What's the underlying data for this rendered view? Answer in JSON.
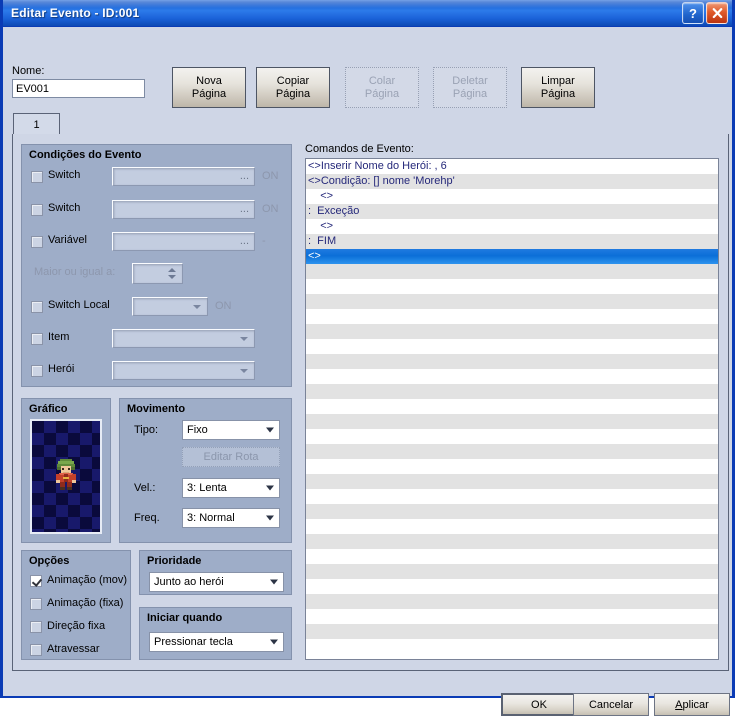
{
  "window": {
    "title": "Editar Evento - ID:001",
    "help_button": "?",
    "close_button": "✕"
  },
  "header": {
    "name_label": "Nome:",
    "name_value": "EV001",
    "page_buttons": [
      {
        "label": "Nova\nPágina",
        "name": "nova-pagina",
        "disabled": false
      },
      {
        "label": "Copiar\nPágina",
        "name": "copiar-pagina",
        "disabled": false
      },
      {
        "label": "Colar\nPágina",
        "name": "colar-pagina",
        "disabled": true
      },
      {
        "label": "Deletar\nPágina",
        "name": "deletar-pagina",
        "disabled": true
      },
      {
        "label": "Limpar\nPágina",
        "name": "limpar-pagina",
        "disabled": false
      }
    ]
  },
  "tabs": [
    {
      "label": "1",
      "active": true
    }
  ],
  "conditions": {
    "title": "Condições do Evento",
    "rows": [
      {
        "label": "Switch",
        "checked": false,
        "value": "",
        "dots": "...",
        "suffix": "ON"
      },
      {
        "label": "Switch",
        "checked": false,
        "value": "",
        "dots": "...",
        "suffix": "ON"
      },
      {
        "label": "Variável",
        "checked": false,
        "value": "",
        "dots": "...",
        "suffix": "-"
      },
      {
        "label": "Maior ou igual a:",
        "checked": null,
        "value": "",
        "dots": "",
        "suffix": ""
      },
      {
        "label": "Switch Local",
        "checked": false,
        "value": "",
        "dots": "",
        "suffix": "ON"
      },
      {
        "label": "Item",
        "checked": false,
        "value": "",
        "dots": "",
        "suffix": ""
      },
      {
        "label": "Herói",
        "checked": false,
        "value": "",
        "dots": "",
        "suffix": ""
      }
    ]
  },
  "graphic": {
    "title": "Gráfico",
    "sprite_name": "hero-sprite-green-hair-red-armor"
  },
  "movement": {
    "title": "Movimento",
    "tipo_label": "Tipo:",
    "tipo_value": "Fixo",
    "editar_rota_label": "Editar Rota",
    "vel_label": "Vel.:",
    "vel_value": "3: Lenta",
    "freq_label": "Freq.",
    "freq_value": "3: Normal"
  },
  "options": {
    "title": "Opções",
    "items": [
      {
        "label": "Animação (mov)",
        "checked": true
      },
      {
        "label": "Animação (fixa)",
        "checked": false
      },
      {
        "label": "Direção fixa",
        "checked": false
      },
      {
        "label": "Atravessar",
        "checked": false
      }
    ]
  },
  "priority": {
    "title": "Prioridade",
    "value": "Junto ao herói"
  },
  "trigger": {
    "title": "Iniciar quando",
    "value": "Pressionar tecla"
  },
  "commands": {
    "title": "Comandos de Evento:",
    "rows": [
      {
        "text": "<>Inserir Nome do Herói: , 6",
        "selected": false
      },
      {
        "text": "<>Condição: [] nome 'Morehp'",
        "selected": false
      },
      {
        "text": "    <>",
        "selected": false
      },
      {
        "text": ":  Exceção",
        "selected": false
      },
      {
        "text": "    <>",
        "selected": false
      },
      {
        "text": ":  FIM",
        "selected": false
      },
      {
        "text": "<>",
        "selected": true
      }
    ],
    "empty_row_count": 26
  },
  "footer": {
    "ok_label": "OK",
    "cancel_label": "Cancelar",
    "apply_label": "Aplicar",
    "apply_mnemonic": "A"
  },
  "colors": {
    "titlebar_blue": "#1a61d8",
    "window_bg": "#cfd6e6",
    "group_bg": "#9eadc8",
    "selection_blue": "#0b6fd8",
    "command_text": "#25287a",
    "disabled_text": "#8d97ad"
  }
}
